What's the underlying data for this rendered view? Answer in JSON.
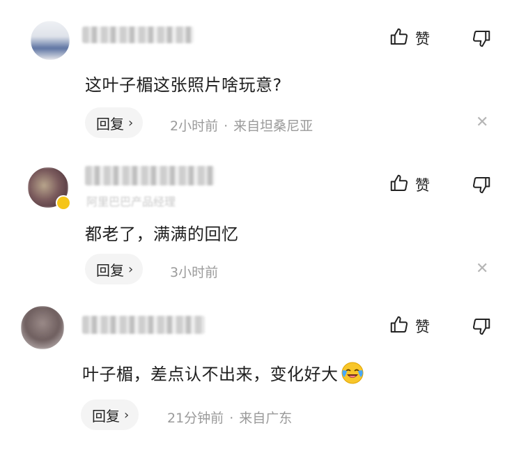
{
  "comments": [
    {
      "content": "这叶子楣这张照片啥玩意?",
      "reply_label": "回复",
      "time": "2小时前",
      "location": "来自坦桑尼亚",
      "like_label": "赞",
      "username_blurred": "",
      "avatar_colors": [
        "#e9e9ee",
        "#6a7fa8"
      ]
    },
    {
      "content": "都老了，满满的回忆",
      "reply_label": "回复",
      "time": "3小时前",
      "location": "",
      "like_label": "赞",
      "sub_label": "阿里巴巴产品经理",
      "avatar_colors": [
        "#6d4a4e",
        "#c6b39a"
      ]
    },
    {
      "content": "叶子楣，差点认不出来，变化好大",
      "reply_label": "回复",
      "time": "21分钟前",
      "location": "来自广东",
      "like_label": "赞",
      "avatar_colors": [
        "#7b6c6a",
        "#d8d0cf"
      ]
    }
  ],
  "colors": {
    "text": "#1f1f1f",
    "meta": "#9a9a9a",
    "reply_bg": "#f4f4f4",
    "close": "#b5b5b5",
    "vip_badge": "#f5c518"
  },
  "icons": [
    "thumbs-up-icon",
    "thumbs-down-icon",
    "close-icon",
    "chevron-right-icon",
    "crying-laugh-emoji"
  ]
}
